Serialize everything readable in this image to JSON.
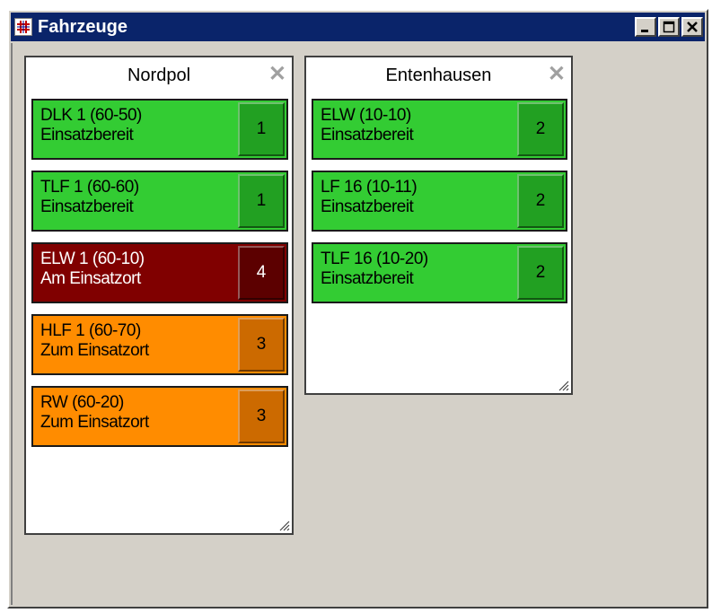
{
  "window": {
    "title": "Fahrzeuge",
    "icon": "grid-app-icon",
    "controls": [
      "minimize-icon",
      "maximize-icon",
      "close-icon"
    ]
  },
  "colors": {
    "einsatzbereit": "#33cc33",
    "einsatzbereit_num": "#22a022",
    "am_einsatzort": "#800000",
    "am_einsatzort_num": "#5c0000",
    "zum_einsatzort": "#ff8c00",
    "zum_einsatzort_num": "#cc6a00"
  },
  "panels": [
    {
      "title": "Nordpol",
      "close": "✕",
      "vehicles": [
        {
          "name": "DLK 1 (60-50)",
          "status": "Einsatzbereit",
          "num": "1"
        },
        {
          "name": "TLF 1 (60-60)",
          "status": "Einsatzbereit",
          "num": "1"
        },
        {
          "name": "ELW 1 (60-10)",
          "status": "Am Einsatzort",
          "num": "4"
        },
        {
          "name": "HLF 1 (60-70)",
          "status": "Zum Einsatzort",
          "num": "3"
        },
        {
          "name": "RW (60-20)",
          "status": "Zum Einsatzort",
          "num": "3"
        }
      ]
    },
    {
      "title": "Entenhausen",
      "close": "✕",
      "vehicles": [
        {
          "name": "ELW (10-10)",
          "status": "Einsatzbereit",
          "num": "2"
        },
        {
          "name": "LF 16 (10-11)",
          "status": "Einsatzbereit",
          "num": "2"
        },
        {
          "name": "TLF 16 (10-20)",
          "status": "Einsatzbereit",
          "num": "2"
        }
      ]
    }
  ]
}
